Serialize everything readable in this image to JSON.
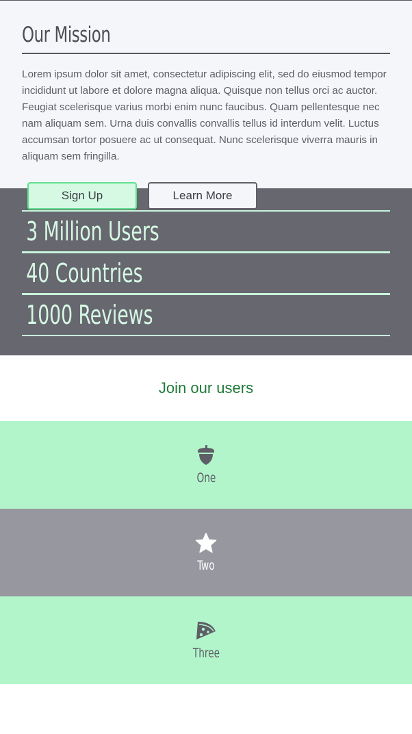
{
  "mission": {
    "title": "Our Mission",
    "body": "Lorem ipsum dolor sit amet, consectetur adipiscing elit, sed do eiusmod tempor incididunt ut labore et dolore magna aliqua. Quisque non tellus orci ac auctor. Feugiat scelerisque varius morbi enim nunc faucibus. Quam pellentesque nec nam aliquam sem. Urna duis convallis convallis tellus id interdum velit. Luctus accumsan tortor posuere ac ut consequat. Nunc scelerisque viverra mauris in aliquam sem fringilla.",
    "signup_label": "Sign Up",
    "learn_label": "Learn More"
  },
  "stats": [
    {
      "text": "3 Million Users"
    },
    {
      "text": "40 Countries"
    },
    {
      "text": "1000 Reviews"
    }
  ],
  "join": {
    "text": "Join our users"
  },
  "tiles": [
    {
      "label": "One",
      "icon": "acorn-icon",
      "bg": "#b2f5ca"
    },
    {
      "label": "Two",
      "icon": "star-icon",
      "bg": "#97979f"
    },
    {
      "label": "Three",
      "icon": "pizza-slice-icon",
      "bg": "#b2f5ca"
    }
  ],
  "colors": {
    "accent_green": "#5fe08f",
    "light_green": "#b2f5ca",
    "dark_gray": "#67676f",
    "join_text": "#1f7a38"
  }
}
